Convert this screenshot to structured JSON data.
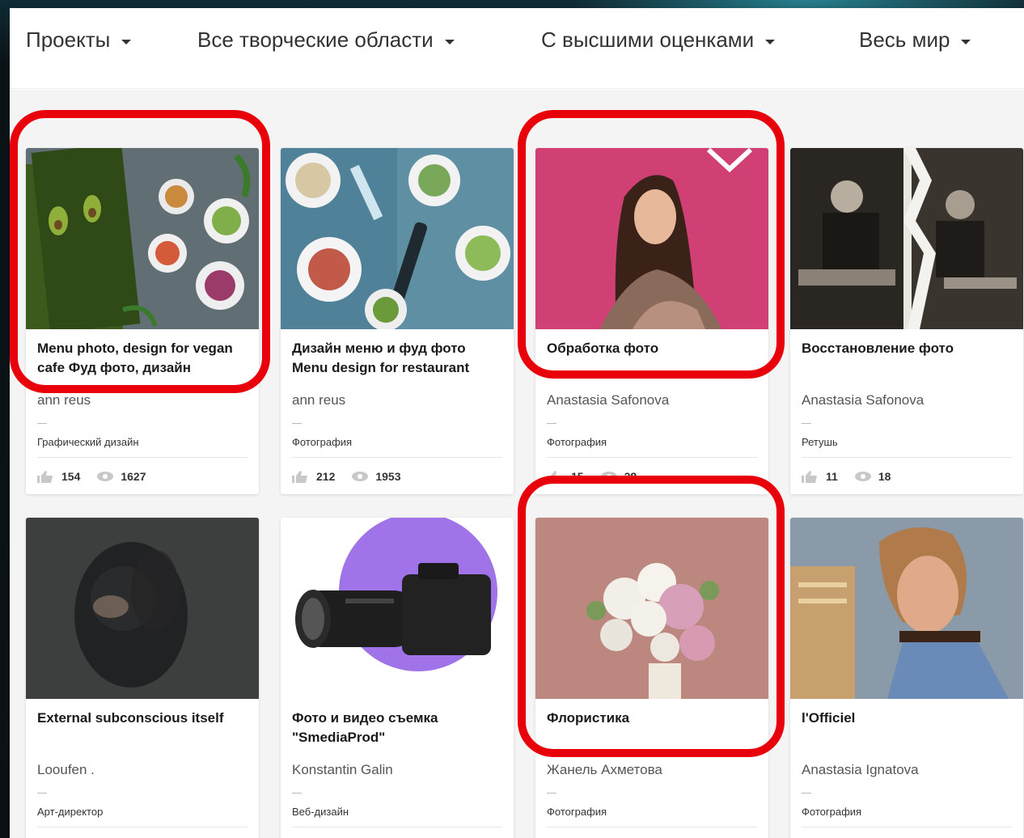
{
  "nav": {
    "projects": "Проекты",
    "fields": "Все творческие области",
    "sort": "С высшими оценками",
    "location": "Весь мир"
  },
  "projects": [
    {
      "title": "Menu photo, design for vegan cafe Фуд фото, дизайн",
      "owner": "ann reus",
      "field": "Графический дизайн",
      "likes": "154",
      "views": "1627"
    },
    {
      "title": "Дизайн меню и фуд фото Menu design for restaurant",
      "owner": "ann reus",
      "field": "Фотография",
      "likes": "212",
      "views": "1953"
    },
    {
      "title": "Обработка фото",
      "owner": "Anastasia Safonova",
      "field": "Фотография",
      "likes": "15",
      "views": "28"
    },
    {
      "title": "Восстановление фото",
      "owner": "Anastasia Safonova",
      "field": "Ретушь",
      "likes": "11",
      "views": "18"
    },
    {
      "title": "External subconscious itself",
      "owner": "Looufen .",
      "field": "Арт-директор",
      "likes": "",
      "views": ""
    },
    {
      "title": "Фото и видео съемка \"SmediaProd\"",
      "owner": "Konstantin Galin",
      "field": "Веб-дизайн",
      "likes": "",
      "views": ""
    },
    {
      "title": "Флористика",
      "owner": "Жанель Ахметова",
      "field": "Фотография",
      "likes": "",
      "views": ""
    },
    {
      "title": "l'Officiel",
      "owner": "Anastasia Ignatova",
      "field": "Фотография",
      "likes": "",
      "views": ""
    }
  ],
  "icons": {
    "like": "thumbs-up-icon",
    "view": "eye-icon",
    "caret": "chevron-down-icon"
  },
  "colors": {
    "highlight": "#e8000b",
    "text": "#333333",
    "background": "#f4f4f4"
  }
}
